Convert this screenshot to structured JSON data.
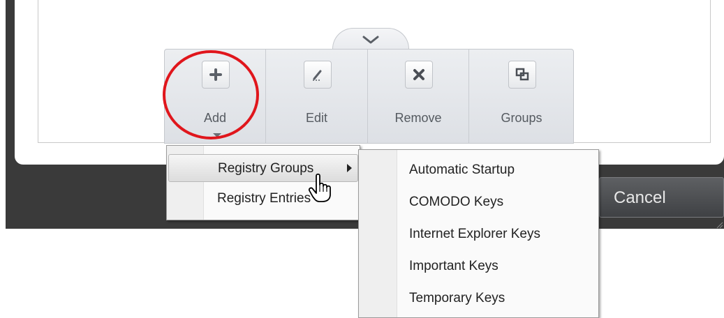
{
  "toolbar": {
    "buttons": [
      {
        "label": "Add",
        "icon": "plus-icon"
      },
      {
        "label": "Edit",
        "icon": "pencil-icon"
      },
      {
        "label": "Remove",
        "icon": "x-icon"
      },
      {
        "label": "Groups",
        "icon": "groups-icon"
      }
    ]
  },
  "dialog": {
    "cancel_label": "Cancel"
  },
  "add_menu": {
    "items": [
      "Registry Groups",
      "Registry Entries"
    ]
  },
  "registry_groups_submenu": {
    "items": [
      "Automatic Startup",
      "COMODO Keys",
      "Internet Explorer Keys",
      "Important Keys",
      "Temporary Keys"
    ]
  },
  "colors": {
    "highlight_circle": "#e0161c",
    "dark_background": "#3a3a3a",
    "toolbar_background": "#e3e6ea"
  }
}
